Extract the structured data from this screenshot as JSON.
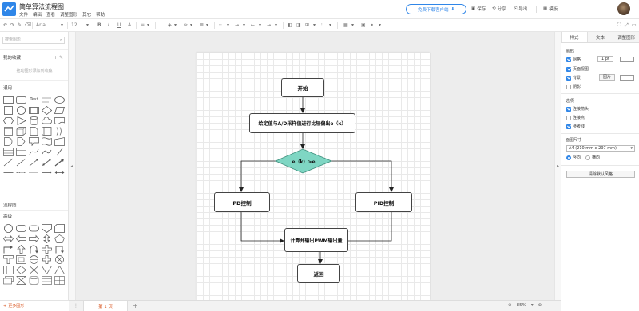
{
  "app": {
    "title": "简单算法流程图",
    "menu": [
      "文件",
      "编辑",
      "查看",
      "调整图形",
      "其它",
      "帮助"
    ],
    "download_button": "免费下载客户端",
    "actions": [
      {
        "label": "保存",
        "icon": "save-icon"
      },
      {
        "label": "分享",
        "icon": "share-icon"
      },
      {
        "label": "导出",
        "icon": "export-icon"
      },
      {
        "label": "模板",
        "icon": "template-icon"
      }
    ]
  },
  "toolbar": {
    "font_family": "Arial",
    "font_size": "12"
  },
  "left_panel": {
    "search_placeholder": "搜索图形",
    "favorites_title": "我的收藏",
    "favorites_empty": "拖动图形添加到收藏",
    "general_title": "通用",
    "flowchart_title": "流程图",
    "advanced_title": "高级",
    "more_shapes": "更多图形"
  },
  "flowchart": {
    "start": "开始",
    "compare": "给定值与A/D采样值进行比较偏出e（k）",
    "decision": "e（k）>e",
    "pd": "PD控制",
    "pid": "PID控制",
    "output": "计算并输出PWM输出量",
    "return": "返回"
  },
  "right_panel": {
    "tabs": [
      "样式",
      "文本",
      "调整图形"
    ],
    "canvas_section": "画布",
    "grid_label": "网格",
    "grid_size": "1 pt",
    "page_view_label": "页面视图",
    "background_label": "背景",
    "image_button": "图片",
    "shadow_label": "阴影",
    "options_section": "选项",
    "connection_arrows": "连接箭头",
    "connection_points": "连接点",
    "guides": "参考线",
    "paper_size_section": "面图尺寸",
    "paper_size_value": "A4 (210 mm x 297 mm)",
    "portrait": "竖向",
    "landscape": "横向",
    "reset_button": "清除默认风格"
  },
  "bottom_bar": {
    "page_tab": "第 1 页",
    "zoom": "85%"
  },
  "colors": {
    "accent": "#2f86e8",
    "decision_fill": "#7fd6c3",
    "page_tab_active": "#d9541e"
  }
}
